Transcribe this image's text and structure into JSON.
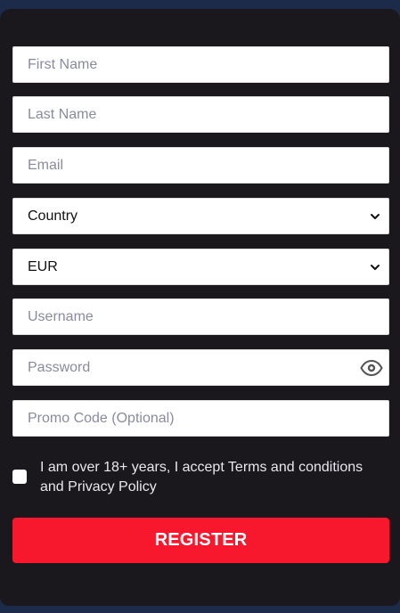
{
  "form": {
    "first_name": {
      "placeholder": "First Name",
      "value": ""
    },
    "last_name": {
      "placeholder": "Last Name",
      "value": ""
    },
    "email": {
      "placeholder": "Email",
      "value": ""
    },
    "country": {
      "selected": "Country",
      "icon": "chevron-down-icon"
    },
    "currency": {
      "selected": "EUR",
      "icon": "chevron-down-icon"
    },
    "username": {
      "placeholder": "Username",
      "value": ""
    },
    "password": {
      "placeholder": "Password",
      "value": "",
      "toggle_icon": "eye-icon"
    },
    "promo_code": {
      "placeholder": "Promo Code (Optional)",
      "value": ""
    },
    "consent": {
      "checked": false,
      "text": "I am over 18+ years, I accept Terms and conditions and Privacy Policy"
    },
    "register_label": "REGISTER"
  },
  "colors": {
    "panel_background": "#1a171d",
    "page_background": "#1c2b4a",
    "accent": "#f8182e",
    "input_background": "#ffffff",
    "placeholder": "#8a8aa0",
    "text_light": "#e8e8ec"
  }
}
